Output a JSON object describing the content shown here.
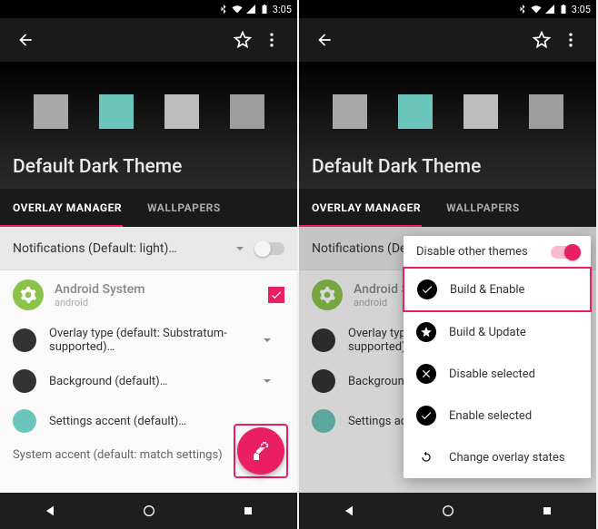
{
  "status": {
    "time": "3:05"
  },
  "hero": {
    "title": "Default Dark Theme",
    "swatches": [
      "#a8a8a8",
      "#6cc5bb",
      "#bdbdbd",
      "#9e9e9e"
    ]
  },
  "tabs": {
    "active": "OVERLAY MANAGER",
    "inactive": "WALLPAPERS"
  },
  "notif_row": "Notifications (Default: light)…",
  "app": {
    "title": "Android System",
    "sub": "android"
  },
  "opts": [
    {
      "color": "#333333",
      "label": "Overlay type (default: Substratum-supported)…"
    },
    {
      "color": "#333333",
      "label": "Background (default)…"
    },
    {
      "color": "#6cc5bb",
      "label": "Settings accent (default)…"
    }
  ],
  "truncated": "System accent (default: match settings)",
  "menu": {
    "header": "Disable other themes",
    "items": [
      {
        "icon": "check-circle",
        "label": "Build & Enable",
        "highlight": true
      },
      {
        "icon": "star-circle",
        "label": "Build & Update"
      },
      {
        "icon": "x-circle",
        "label": "Disable selected"
      },
      {
        "icon": "check-circle",
        "label": "Enable selected"
      },
      {
        "icon": "refresh",
        "label": "Change overlay states"
      }
    ]
  }
}
